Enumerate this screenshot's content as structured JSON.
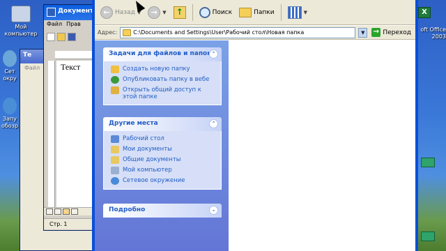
{
  "desktop": {
    "icons": [
      {
        "label": "Мой компьютер",
        "icon": "computer-icon",
        "color": "#c9d4e6"
      },
      {
        "label": "Сет окру",
        "icon": "network-icon",
        "color": "#6aa6d8"
      },
      {
        "label": "Запу обозр",
        "icon": "ie-icon",
        "color": "#4a8fd6"
      }
    ],
    "right_text": "oft Office 2003"
  },
  "background_window_a": {
    "title": "Те",
    "menu": "Файл"
  },
  "word_window": {
    "title": "Документ",
    "menu": [
      "Файл",
      "Прав"
    ],
    "doc_text": "Текст",
    "status": "Стр. 1"
  },
  "explorer": {
    "toolbar": {
      "back_label": "Назад",
      "search_label": "Поиск",
      "folders_label": "Папки"
    },
    "address": {
      "label": "Адрес:",
      "path": "C:\\Documents and Settings\\User\\Рабочий стол\\Новая папка",
      "go_label": "Переход"
    },
    "tasks": {
      "header": "Задачи для файлов и папок",
      "items": [
        {
          "label": "Создать новую папку",
          "icon": "new-folder-icon",
          "color": "#f0c040"
        },
        {
          "label": "Опубликовать папку в вебе",
          "icon": "globe-icon",
          "color": "#3a9a3a"
        },
        {
          "label": "Открыть общий доступ к этой папке",
          "icon": "share-folder-icon",
          "color": "#e0b040"
        }
      ]
    },
    "places": {
      "header": "Другие места",
      "items": [
        {
          "label": "Рабочий стол",
          "icon": "desktop-icon",
          "color": "#5a8ad8"
        },
        {
          "label": "Мои документы",
          "icon": "my-documents-icon",
          "color": "#e8c860"
        },
        {
          "label": "Общие документы",
          "icon": "shared-documents-icon",
          "color": "#e8c860"
        },
        {
          "label": "Мой компьютер",
          "icon": "computer-icon",
          "color": "#9ab0d0"
        },
        {
          "label": "Сетевое окружение",
          "icon": "network-icon",
          "color": "#4a8ad8"
        }
      ]
    },
    "details": {
      "header": "Подробно"
    }
  }
}
